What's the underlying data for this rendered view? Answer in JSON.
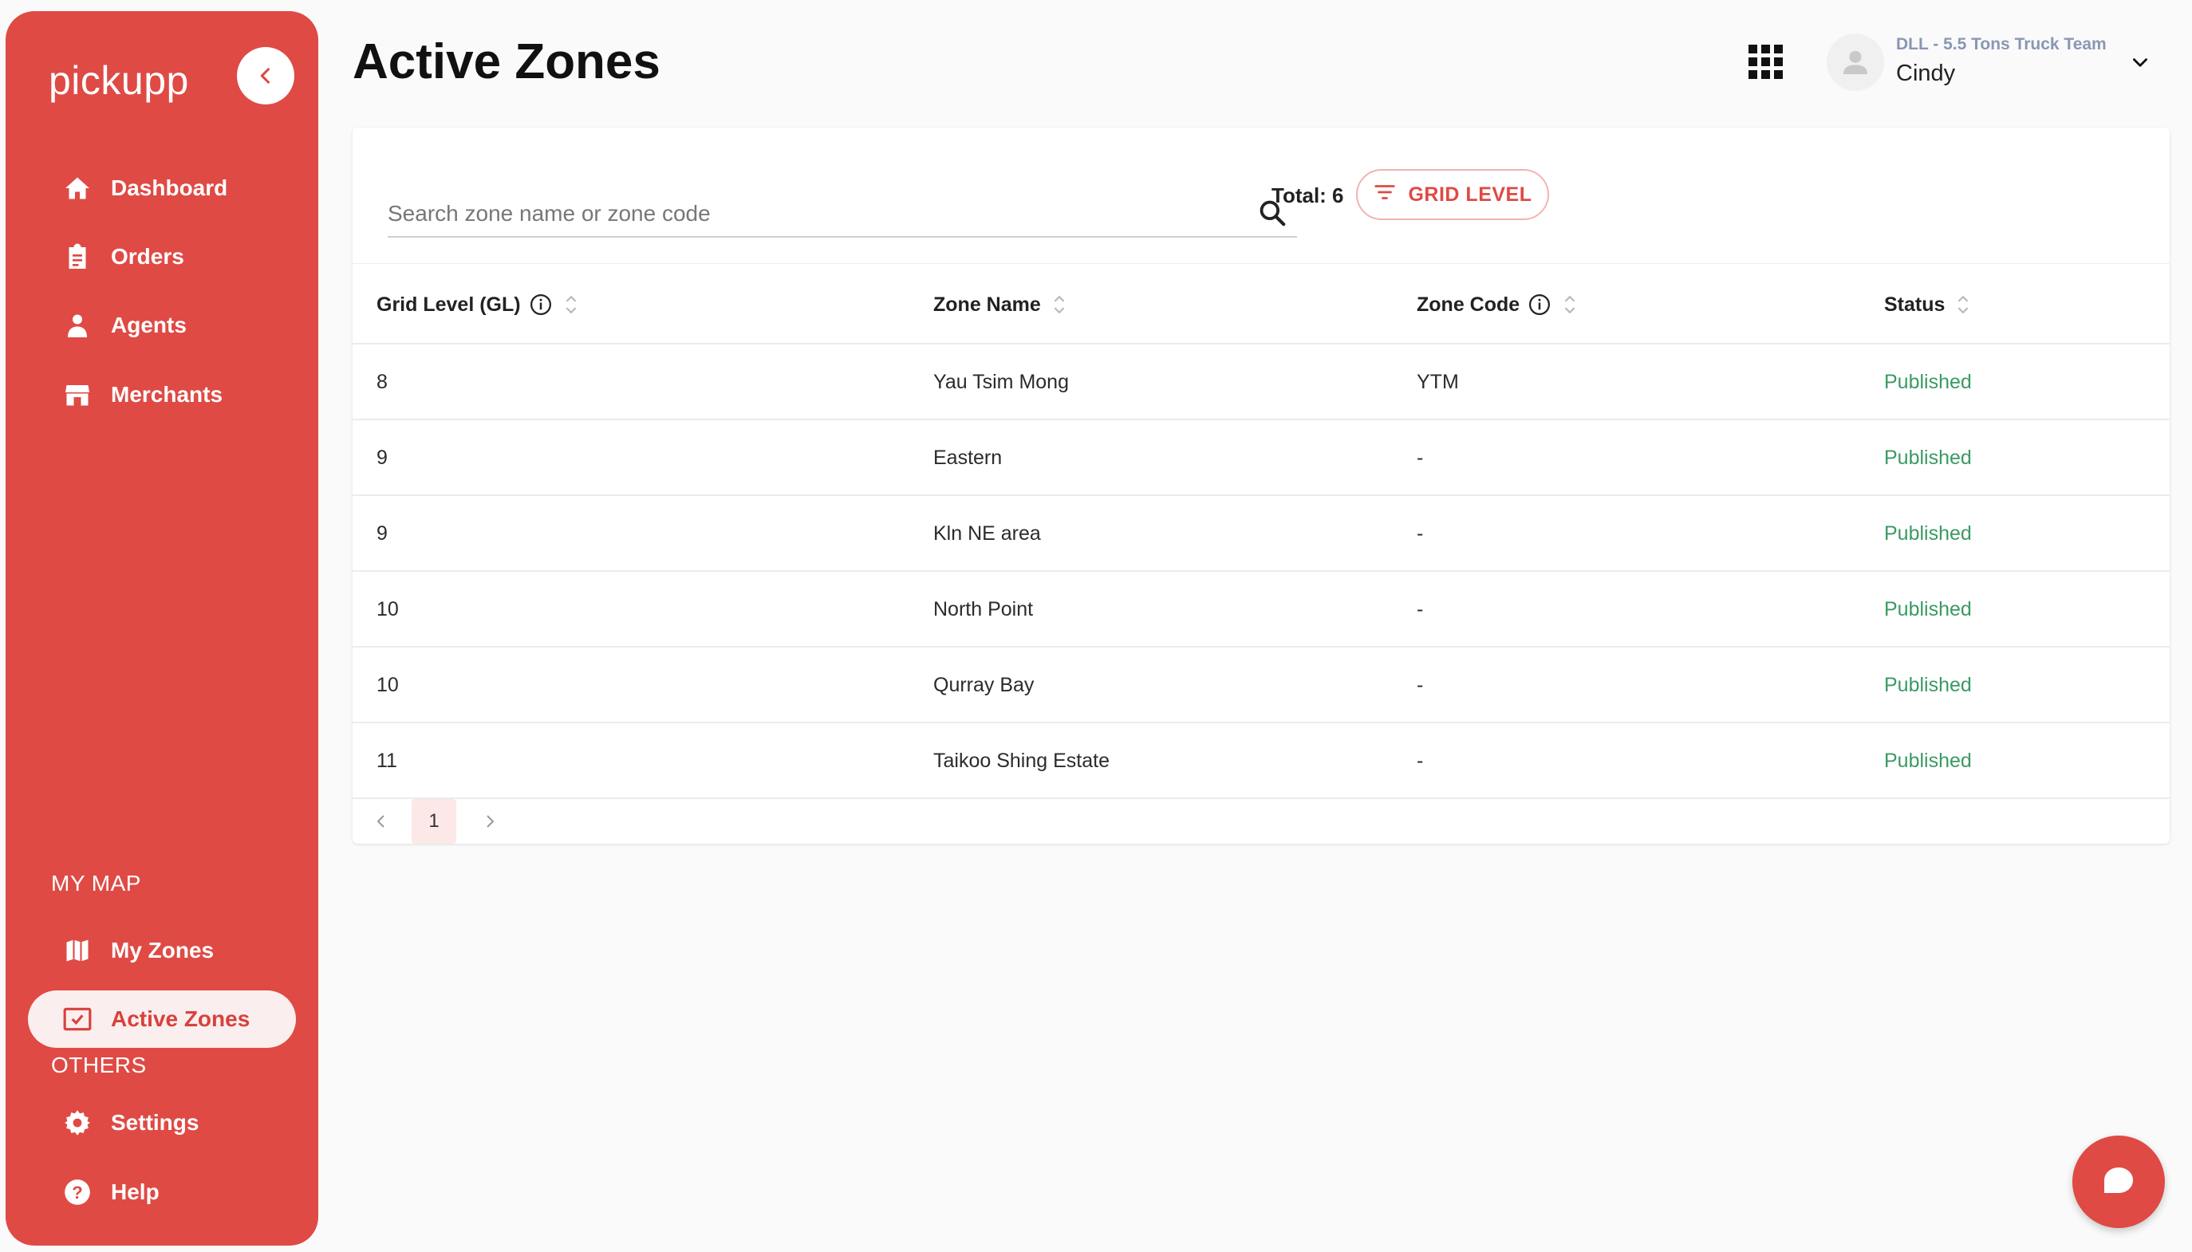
{
  "sidebar": {
    "logo": "pickupp",
    "items": [
      {
        "label": "Dashboard",
        "icon": "home-icon"
      },
      {
        "label": "Orders",
        "icon": "clipboard-icon"
      },
      {
        "label": "Agents",
        "icon": "agent-icon"
      },
      {
        "label": "Merchants",
        "icon": "store-icon"
      }
    ],
    "section_map": "MY MAP",
    "map_items": [
      {
        "label": "My Zones",
        "icon": "map-icon"
      },
      {
        "label": "Active Zones",
        "icon": "checked-box-icon",
        "active": true
      }
    ],
    "section_others": "OTHERS",
    "other_items": [
      {
        "label": "Settings",
        "icon": "gear-icon"
      },
      {
        "label": "Help",
        "icon": "help-icon"
      }
    ]
  },
  "header": {
    "title": "Active Zones",
    "team": "DLL - 5.5 Tons Truck Team",
    "user": "Cindy"
  },
  "toolbar": {
    "search_placeholder": "Search zone name or zone code",
    "total": "Total: 6",
    "filter_label": "GRID LEVEL"
  },
  "table": {
    "columns": [
      "Grid Level (GL)",
      "Zone Name",
      "Zone Code",
      "Status"
    ],
    "rows": [
      {
        "gl": "8",
        "zone_name": "Yau Tsim Mong",
        "zone_code": "YTM",
        "status": "Published"
      },
      {
        "gl": "9",
        "zone_name": "Eastern",
        "zone_code": "-",
        "status": "Published"
      },
      {
        "gl": "9",
        "zone_name": "Kln NE area",
        "zone_code": "-",
        "status": "Published"
      },
      {
        "gl": "10",
        "zone_name": "North Point",
        "zone_code": "-",
        "status": "Published"
      },
      {
        "gl": "10",
        "zone_name": "Qurray Bay",
        "zone_code": "-",
        "status": "Published"
      },
      {
        "gl": "11",
        "zone_name": "Taikoo Shing Estate",
        "zone_code": "-",
        "status": "Published"
      }
    ]
  },
  "pagination": {
    "current": "1"
  },
  "colors": {
    "brand": "#df4a45",
    "status_published": "#3a9a63"
  }
}
